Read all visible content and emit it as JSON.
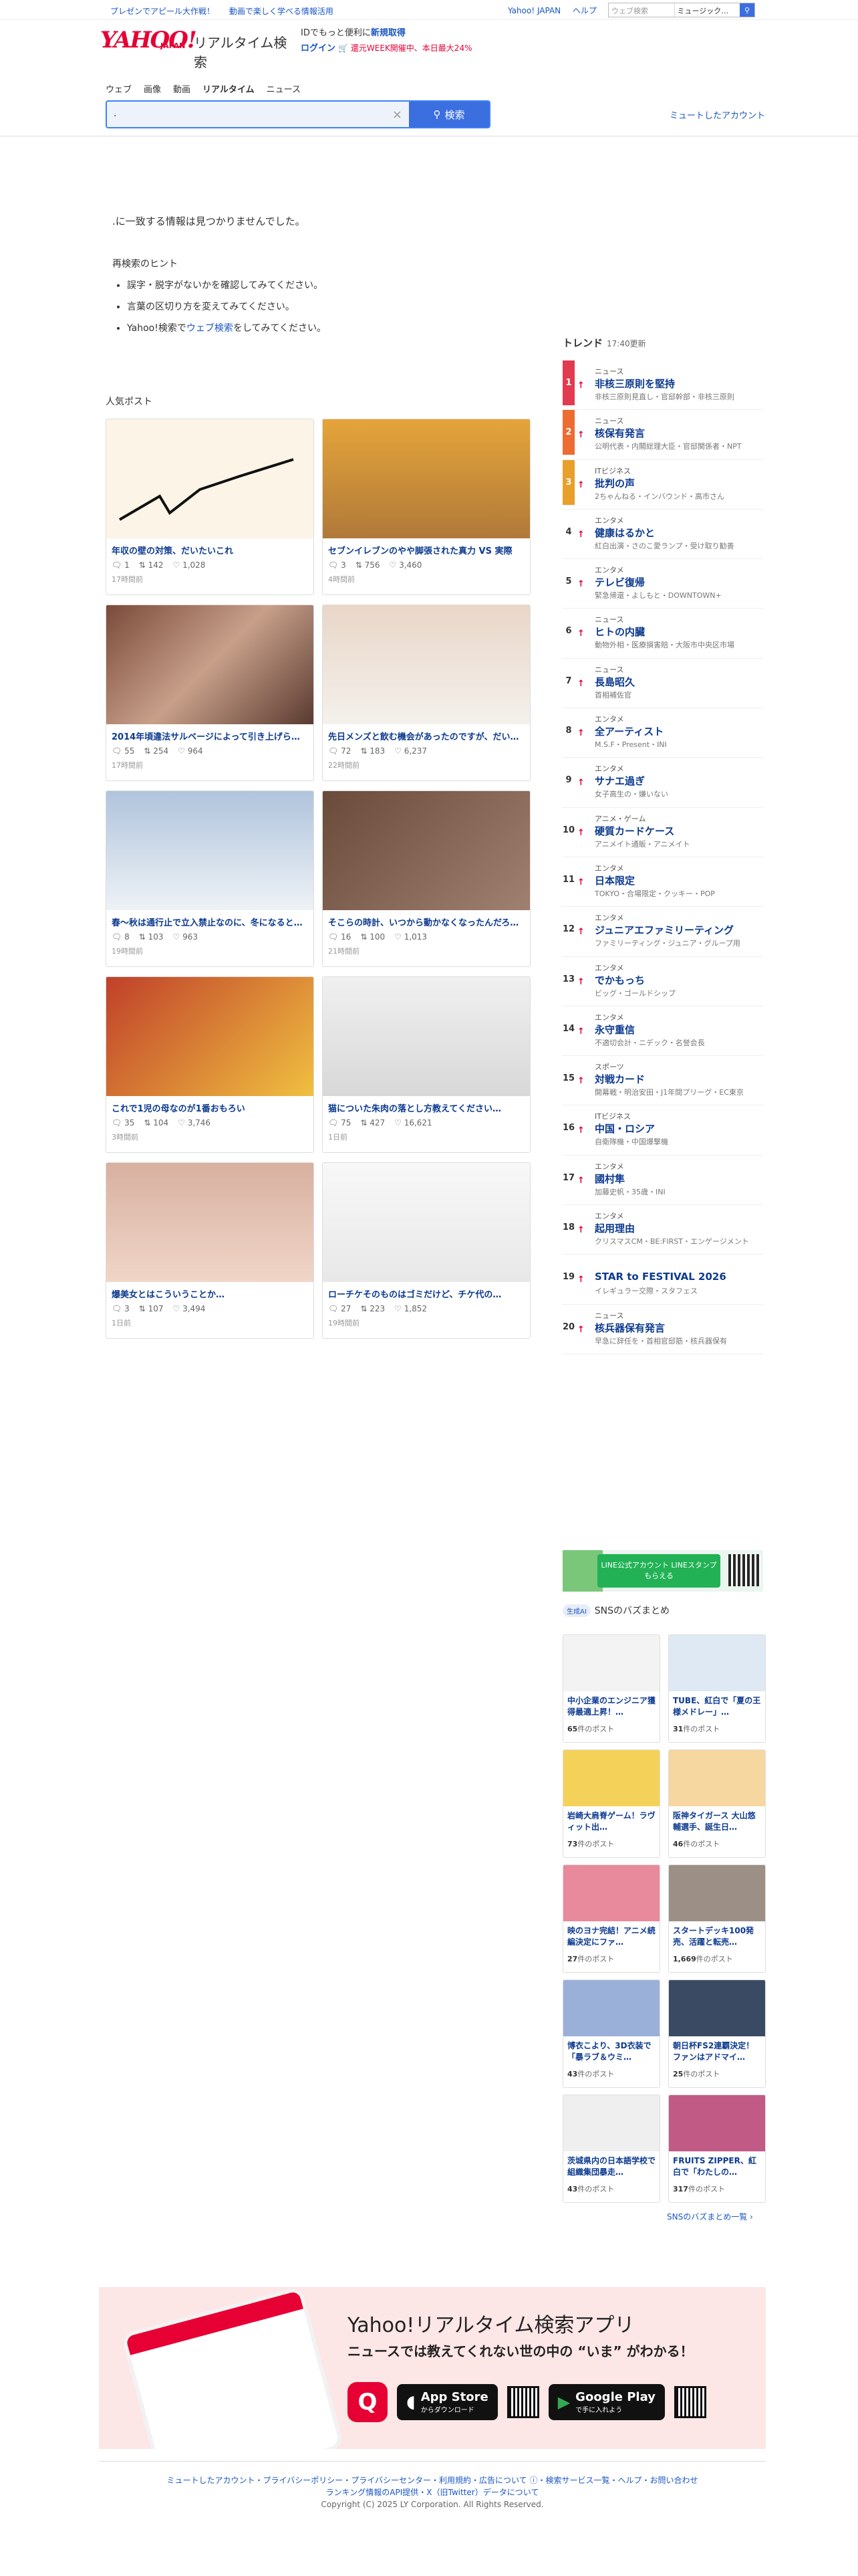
{
  "topbar": {
    "promo": [
      "プレゼンでアピール大作戦！",
      "動画で楽しく学べる情報活用"
    ],
    "links": [
      "Yahoo! JAPAN",
      "ヘルプ"
    ],
    "search_placeholder": "ウェブ検索",
    "search_value": "ミュージック…"
  },
  "brand": {
    "logo": "YAHOO!",
    "logo_sub": "JAPAN",
    "service": "リアルタイム検索"
  },
  "login": {
    "line1_prefix": "IDでもっと便利に",
    "line1_link": "新規取得",
    "line2_login": "ログイン",
    "line2_promo": "🛒 還元WEEK開催中、本日最大24%"
  },
  "tabs": [
    "ウェブ",
    "画像",
    "動画",
    "リアルタイム",
    "ニュース"
  ],
  "search": {
    "value": ".",
    "button": "検索",
    "muted_link": "ミュートしたアカウント"
  },
  "noresult": ".に一致する情報は見つかりませんでした。",
  "hints": {
    "title": "再検索のヒント",
    "items": [
      "誤字・脱字がないかを確認してみてください。",
      "言葉の区切り方を変えてみてください。"
    ],
    "item3_prefix": "Yahoo!検索で",
    "item3_link": "ウェブ検索",
    "item3_suffix": "をしてみてください。"
  },
  "popular": {
    "title": "人気ポスト",
    "posts": [
      {
        "title": "年収の壁の対策、だいたいこれ",
        "replies": "1",
        "reposts": "142",
        "likes": "1,028",
        "time": "17時間前"
      },
      {
        "title": "セブンイレブンのやや脚張された真力 VS 実際",
        "replies": "3",
        "reposts": "756",
        "likes": "3,460",
        "time": "4時間前"
      },
      {
        "title": "2014年頃違法サルベージによって引き上げられた旧日…",
        "replies": "55",
        "reposts": "254",
        "likes": "964",
        "time": "17時間前"
      },
      {
        "title": "先日メンズと飲む機会があったのですが、だいた…",
        "replies": "72",
        "reposts": "183",
        "likes": "6,237",
        "time": "22時間前"
      },
      {
        "title": "春〜秋は通行止で立入禁止なのに、冬になると…",
        "replies": "8",
        "reposts": "103",
        "likes": "963",
        "time": "19時間前"
      },
      {
        "title": "そこらの時計、いつから動かなくなったんだろ…",
        "replies": "16",
        "reposts": "100",
        "likes": "1,013",
        "time": "21時間前"
      },
      {
        "title": "これで1児の母なのが1番おもろい",
        "replies": "35",
        "reposts": "104",
        "likes": "3,746",
        "time": "3時間前"
      },
      {
        "title": "猫についた朱肉の落とし方教えてください…",
        "replies": "75",
        "reposts": "427",
        "likes": "16,621",
        "time": "1日前"
      },
      {
        "title": "爆美女とはこういうことか…",
        "replies": "3",
        "reposts": "107",
        "likes": "3,494",
        "time": "1日前"
      },
      {
        "title": "ローチケそのものはゴミだけど、チケ代の…",
        "replies": "27",
        "reposts": "223",
        "likes": "1,852",
        "time": "19時間前"
      }
    ]
  },
  "trend": {
    "title": "トレンド",
    "updated": "17:40更新",
    "items": [
      {
        "rank": "1",
        "cat": "ニュース",
        "kw": "非核三原則を堅持",
        "rel": "非核三原則見直し・官邸幹部・非核三原則"
      },
      {
        "rank": "2",
        "cat": "ニュース",
        "kw": "核保有発言",
        "rel": "公明代表・内閣総理大臣・官邸関係者・NPT"
      },
      {
        "rank": "3",
        "cat": "ITビジネス",
        "kw": "批判の声",
        "rel": "2ちゃんねる・インバウンド・高市さん"
      },
      {
        "rank": "4",
        "cat": "エンタメ",
        "kw": "健康はるかと",
        "rel": "紅白出演・さのこ愛ランプ・受け取り勧善"
      },
      {
        "rank": "5",
        "cat": "エンタメ",
        "kw": "テレビ復帰",
        "rel": "緊急帰還・よしもと・DOWNTOWN+"
      },
      {
        "rank": "6",
        "cat": "ニュース",
        "kw": "ヒトの内臓",
        "rel": "動物外相・医療損害賠・大阪市中央区市場"
      },
      {
        "rank": "7",
        "cat": "ニュース",
        "kw": "長島昭久",
        "rel": "首相補佐官"
      },
      {
        "rank": "8",
        "cat": "エンタメ",
        "kw": "全アーティスト",
        "rel": "M.S.F・Present・INI"
      },
      {
        "rank": "9",
        "cat": "エンタメ",
        "kw": "サナエ過ぎ",
        "rel": "女子高生の・嫌いない"
      },
      {
        "rank": "10",
        "cat": "アニメ・ゲーム",
        "kw": "硬質カードケース",
        "rel": "アニメイト通販・アニメイト"
      },
      {
        "rank": "11",
        "cat": "エンタメ",
        "kw": "日本限定",
        "rel": "TOKYO・合場限定・クッキー・POP"
      },
      {
        "rank": "12",
        "cat": "エンタメ",
        "kw": "ジュニアエファミリーティング",
        "rel": "ファミリーティング・ジュニア・グループ用"
      },
      {
        "rank": "13",
        "cat": "エンタメ",
        "kw": "でかもっち",
        "rel": "ビッグ・ゴールドシップ"
      },
      {
        "rank": "14",
        "cat": "エンタメ",
        "kw": "永守重信",
        "rel": "不適切会計・ニデック・名誉会長"
      },
      {
        "rank": "15",
        "cat": "スポーツ",
        "kw": "対戦カード",
        "rel": "開幕戦・明治安田・J1年間プリーグ・EC東京"
      },
      {
        "rank": "16",
        "cat": "ITビジネス",
        "kw": "中国・ロシア",
        "rel": "自衛隊機・中国爆撃機"
      },
      {
        "rank": "17",
        "cat": "エンタメ",
        "kw": "國村隼",
        "rel": "加藤史帆・35歳・INI"
      },
      {
        "rank": "18",
        "cat": "エンタメ",
        "kw": "起用理由",
        "rel": "クリスマスCM・BE:FIRST・エンゲージメント"
      },
      {
        "rank": "19",
        "cat": "",
        "kw": "STAR to FESTIVAL 2026",
        "rel": "イレギュラー交際・スタフェス"
      },
      {
        "rank": "20",
        "cat": "ニュース",
        "kw": "核兵器保有発言",
        "rel": "早急に辞任を・首相官邸筋・核兵器保有"
      }
    ]
  },
  "ad": {
    "text": "LINE公式アカウント LINEスタンプもらえる"
  },
  "sns": {
    "badge": "生成AI",
    "title": "SNSのバズまとめ",
    "more": "SNSのバズまとめ一覧 ›",
    "items": [
      {
        "title": "中小企業のエンジニア獲得最適上昇！…",
        "count": "65",
        "unit": "件のポスト",
        "color": "#f3f3f3"
      },
      {
        "title": "TUBE、紅白で「夏の王様メドレー」…",
        "count": "31",
        "unit": "件のポスト",
        "color": "#dfe9f3"
      },
      {
        "title": "岩崎大肩脊ゲーム！ラヴィット出…",
        "count": "73",
        "unit": "件のポスト",
        "color": "#f4d25a"
      },
      {
        "title": "阪神タイガース 大山悠輔選手、誕生日…",
        "count": "46",
        "unit": "件のポスト",
        "color": "#f7d7a0"
      },
      {
        "title": "映のヨナ完結！アニメ続編決定にファ…",
        "count": "27",
        "unit": "件のポスト",
        "color": "#e88a9c"
      },
      {
        "title": "スタートデッキ100発売、活躍と転売…",
        "count": "1,669",
        "unit": "件のポスト",
        "color": "#9c8f86"
      },
      {
        "title": "博衣こより、3D衣装で「暴ラブ＆ウミ…",
        "count": "43",
        "unit": "件のポスト",
        "color": "#9ab0d8"
      },
      {
        "title": "朝日杯FS2連覇決定！ファンはアドマイ…",
        "count": "25",
        "unit": "件のポスト",
        "color": "#3b4a63"
      },
      {
        "title": "茨城県内の日本語学校で組織集団暴走…",
        "count": "43",
        "unit": "件のポスト",
        "color": "#efefef"
      },
      {
        "title": "FRUITS ZIPPER、紅白で「わたしの…",
        "count": "317",
        "unit": "件のポスト",
        "color": "#c25a86"
      }
    ]
  },
  "app": {
    "title": "Yahoo!リアルタイム検索アプリ",
    "sub": "ニュースでは教えてくれない世の中の “いま” がわかる！",
    "appstore_small": "",
    "appstore": "App Store",
    "appstore_note": "からダウンロード",
    "gplay_small": "",
    "gplay": "Google Play",
    "gplay_note": "で手に入れよう"
  },
  "footer": {
    "line1": "ミュートしたアカウント・プライバシーポリシー・プライバシーセンター・利用規約・広告について ⓘ・検索サービス一覧・ヘルプ・お問い合わせ",
    "line2": "ランキング情報のAPI提供・X（旧Twitter）データについて",
    "copyright": "Copyright (C) 2025 LY Corporation. All Rights Reserved."
  }
}
